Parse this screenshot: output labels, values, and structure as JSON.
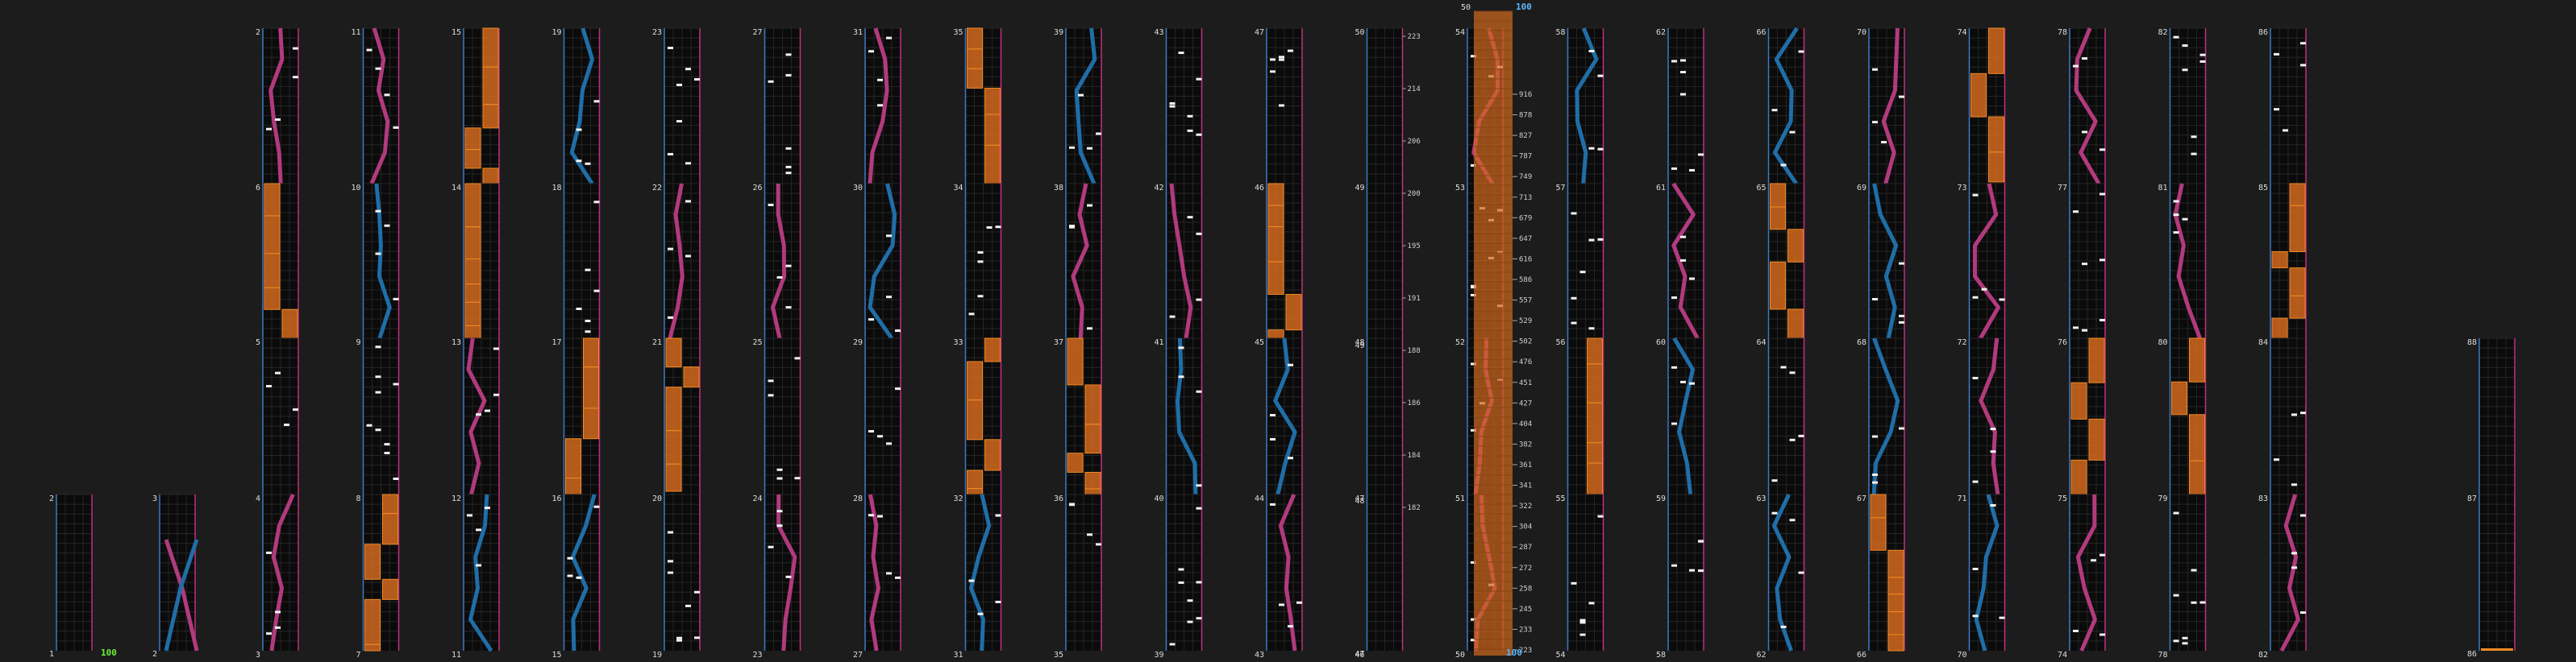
{
  "app": {
    "title": "Chart measure viewer"
  },
  "colors": {
    "background": "#1c1c1c",
    "lane": "#0b0b0b",
    "grid": "#3a3a3a",
    "left_border": "#3f78c4",
    "right_border": "#c0307d",
    "tap": "#f2f2f2",
    "hold": "#d2691e",
    "hold_edge": "#f08a24",
    "slide_pink": "#b23a7e",
    "slide_blue": "#1f6ea8",
    "combo_green": "#6cf03c",
    "combo_blue": "#5bb6ff"
  },
  "measure_rows": {
    "r1": [
      "2",
      "6",
      "5",
      "4",
      "3"
    ],
    "r2": [
      "11",
      "10",
      "9",
      "8",
      "7"
    ],
    "r3": [
      "15",
      "14",
      "13",
      "12",
      "11"
    ],
    "r4": [
      "19",
      "18",
      "17",
      "16",
      "15"
    ],
    "r5": [
      "23",
      "22",
      "21",
      "20",
      "19"
    ],
    "r6": [
      "27",
      "26",
      "25",
      "24",
      "23"
    ],
    "r7": [
      "31",
      "30",
      "29",
      "28",
      "27"
    ],
    "r8": [
      "35",
      "34",
      "33",
      "32",
      "31"
    ],
    "r9": [
      "39",
      "38",
      "37",
      "36",
      "35"
    ],
    "r10": [
      "43",
      "42",
      "41",
      "40",
      "39"
    ],
    "r11": [
      "47",
      "46",
      "45",
      "44",
      "43"
    ],
    "r12": [
      "50",
      "49",
      "48",
      "47",
      "46"
    ],
    "r13": [
      "54",
      "53",
      "52",
      "51",
      "50"
    ],
    "r14": [
      "58",
      "57",
      "56",
      "55",
      "54"
    ],
    "r15": [
      "62",
      "61",
      "60",
      "59",
      "58"
    ],
    "r16": [
      "66",
      "65",
      "64",
      "63",
      "62"
    ],
    "r17": [
      "70",
      "69",
      "68",
      "67",
      "66"
    ],
    "r18": [
      "74",
      "73",
      "72",
      "71",
      "70"
    ],
    "r19": [
      "78",
      "77",
      "76",
      "75",
      "74"
    ],
    "r20": [
      "82",
      "81",
      "80",
      "79",
      "78"
    ],
    "r21": [
      "86",
      "85",
      "84",
      "83",
      "82"
    ]
  },
  "intro_columns": {
    "first": {
      "top": "2",
      "bottom": "1"
    },
    "second": {
      "top": "3",
      "bottom": "2"
    }
  },
  "final_column": {
    "top": "88",
    "mid": "87",
    "bottom": "86"
  },
  "combo_markers": [
    {
      "text": "100",
      "color": "green"
    },
    {
      "text": "100",
      "color": "blue"
    },
    {
      "text": "100",
      "color": "blue"
    }
  ],
  "tempo_ticks": [
    "223",
    "214",
    "206",
    "200",
    "195",
    "191",
    "188",
    "186",
    "184",
    "182"
  ],
  "tempo_measure_labels": [
    "49",
    "48",
    "47"
  ],
  "scale_ticks": [
    "50",
    "916",
    "878",
    "827",
    "787",
    "749",
    "713",
    "679",
    "647",
    "616",
    "586",
    "557",
    "529",
    "502",
    "476",
    "451",
    "427",
    "404",
    "382",
    "361",
    "341",
    "322",
    "304",
    "287",
    "272",
    "258",
    "245",
    "233",
    "223"
  ]
}
